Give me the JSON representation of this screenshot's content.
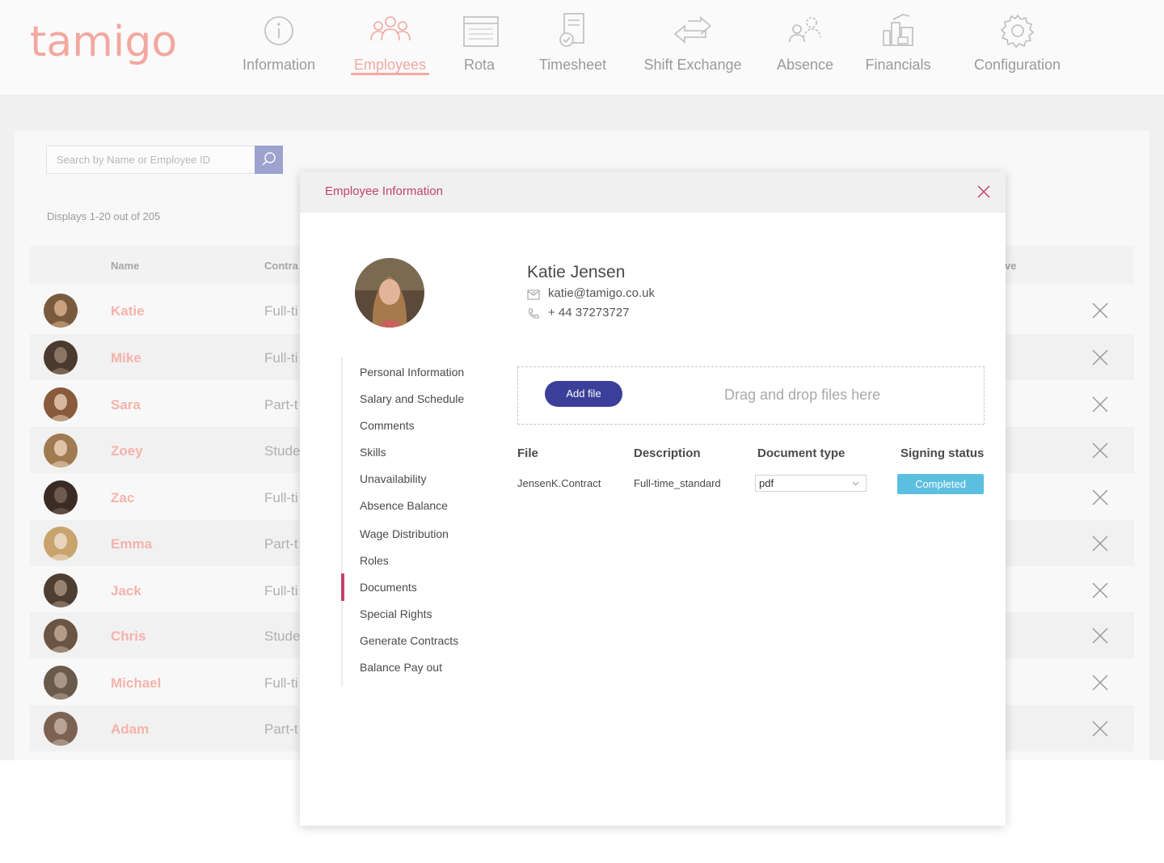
{
  "app": {
    "logo": "tamigo",
    "nav": [
      {
        "label": "Information",
        "icon": "info-icon"
      },
      {
        "label": "Employees",
        "icon": "employees-icon",
        "active": true
      },
      {
        "label": "Rota",
        "icon": "calendar-icon"
      },
      {
        "label": "Timesheet",
        "icon": "clipboard-icon"
      },
      {
        "label": "Shift Exchange",
        "icon": "exchange-arrows-icon"
      },
      {
        "label": "Absence",
        "icon": "absence-users-icon"
      },
      {
        "label": "Financials",
        "icon": "building-chart-icon"
      },
      {
        "label": "Configuration",
        "icon": "gear-icon"
      }
    ],
    "accent_color": "#f2a8a0",
    "modal_accent_color": "#c2436b"
  },
  "employees_list": {
    "search_placeholder": "Search by Name or Employee ID",
    "displays_text": "Displays 1-20 out of 205",
    "columns": {
      "name": "Name",
      "contract": "Contra",
      "active": "ve"
    },
    "rows": [
      {
        "name": "Katie",
        "contract": "Full-ti"
      },
      {
        "name": "Mike",
        "contract": "Full-ti"
      },
      {
        "name": "Sara",
        "contract": "Part-t"
      },
      {
        "name": "Zoey",
        "contract": "Stude"
      },
      {
        "name": "Zac",
        "contract": "Full-ti"
      },
      {
        "name": "Emma",
        "contract": "Part-t"
      },
      {
        "name": "Jack",
        "contract": "Full-ti"
      },
      {
        "name": "Chris",
        "contract": "Stude"
      },
      {
        "name": "Michael",
        "contract": "Full-ti"
      },
      {
        "name": "Adam",
        "contract": "Part-t"
      }
    ]
  },
  "modal": {
    "title": "Employee Information",
    "profile": {
      "name": "Katie Jensen",
      "email": "katie@tamigo.co.uk",
      "phone": "+ 44 37273727"
    },
    "menu": [
      "Personal Information",
      "Salary and Schedule",
      "Comments",
      "Skills",
      "Unavailability",
      "Absence Balance",
      "Wage Distribution",
      "Roles",
      "Documents",
      "Special Rights",
      "Generate Contracts",
      "Balance Pay out"
    ],
    "active_menu": "Documents",
    "upload": {
      "button_label": "Add file",
      "drop_text": "Drag and drop files here"
    },
    "documents_table": {
      "headers": {
        "file": "File",
        "description": "Description",
        "document_type": "Document type",
        "signing_status": "Signing status"
      },
      "rows": [
        {
          "file": "JensenK.Contract",
          "description": "Full-time_standard",
          "document_type": "pdf",
          "signing_status": "Completed"
        }
      ]
    },
    "status_color": "#5bbfe0",
    "button_color": "#3b3f99"
  }
}
